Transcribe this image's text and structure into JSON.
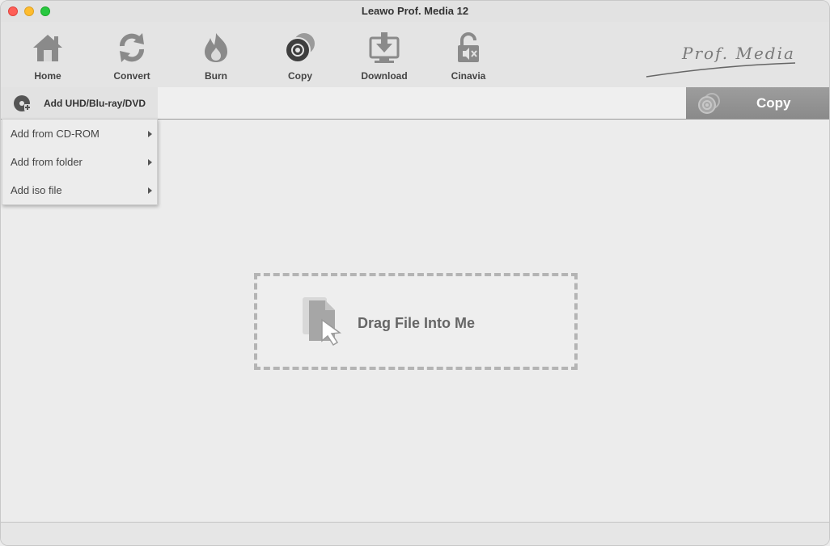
{
  "window": {
    "title": "Leawo Prof. Media 12"
  },
  "toolbar": {
    "items": [
      {
        "label": "Home",
        "icon": "home-icon"
      },
      {
        "label": "Convert",
        "icon": "convert-icon"
      },
      {
        "label": "Burn",
        "icon": "burn-icon"
      },
      {
        "label": "Copy",
        "icon": "copy-icon"
      },
      {
        "label": "Download",
        "icon": "download-icon"
      },
      {
        "label": "Cinavia",
        "icon": "cinavia-icon"
      }
    ],
    "brand": "Prof. Media"
  },
  "subbar": {
    "add_label": "Add UHD/Blu-ray/DVD",
    "copy_label": "Copy"
  },
  "dropdown": {
    "items": [
      {
        "label": "Add from CD-ROM"
      },
      {
        "label": "Add from folder"
      },
      {
        "label": "Add iso file"
      }
    ]
  },
  "dropzone": {
    "text": "Drag File Into Me"
  },
  "colors": {
    "toolbar_bg": "#e4e4e4",
    "copy_button_bg": "#939393",
    "dash_border": "#b4b4b4"
  }
}
